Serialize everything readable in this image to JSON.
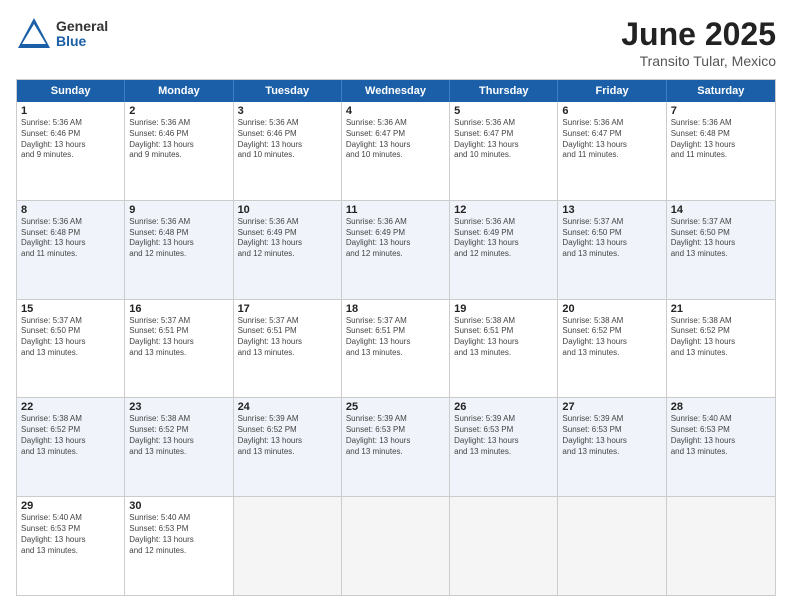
{
  "logo": {
    "general": "General",
    "blue": "Blue"
  },
  "title": "June 2025",
  "subtitle": "Transito Tular, Mexico",
  "header_days": [
    "Sunday",
    "Monday",
    "Tuesday",
    "Wednesday",
    "Thursday",
    "Friday",
    "Saturday"
  ],
  "rows": [
    [
      {
        "day": "1",
        "lines": [
          "Sunrise: 5:36 AM",
          "Sunset: 6:46 PM",
          "Daylight: 13 hours",
          "and 9 minutes."
        ]
      },
      {
        "day": "2",
        "lines": [
          "Sunrise: 5:36 AM",
          "Sunset: 6:46 PM",
          "Daylight: 13 hours",
          "and 9 minutes."
        ]
      },
      {
        "day": "3",
        "lines": [
          "Sunrise: 5:36 AM",
          "Sunset: 6:46 PM",
          "Daylight: 13 hours",
          "and 10 minutes."
        ]
      },
      {
        "day": "4",
        "lines": [
          "Sunrise: 5:36 AM",
          "Sunset: 6:47 PM",
          "Daylight: 13 hours",
          "and 10 minutes."
        ]
      },
      {
        "day": "5",
        "lines": [
          "Sunrise: 5:36 AM",
          "Sunset: 6:47 PM",
          "Daylight: 13 hours",
          "and 10 minutes."
        ]
      },
      {
        "day": "6",
        "lines": [
          "Sunrise: 5:36 AM",
          "Sunset: 6:47 PM",
          "Daylight: 13 hours",
          "and 11 minutes."
        ]
      },
      {
        "day": "7",
        "lines": [
          "Sunrise: 5:36 AM",
          "Sunset: 6:48 PM",
          "Daylight: 13 hours",
          "and 11 minutes."
        ]
      }
    ],
    [
      {
        "day": "8",
        "lines": [
          "Sunrise: 5:36 AM",
          "Sunset: 6:48 PM",
          "Daylight: 13 hours",
          "and 11 minutes."
        ]
      },
      {
        "day": "9",
        "lines": [
          "Sunrise: 5:36 AM",
          "Sunset: 6:48 PM",
          "Daylight: 13 hours",
          "and 12 minutes."
        ]
      },
      {
        "day": "10",
        "lines": [
          "Sunrise: 5:36 AM",
          "Sunset: 6:49 PM",
          "Daylight: 13 hours",
          "and 12 minutes."
        ]
      },
      {
        "day": "11",
        "lines": [
          "Sunrise: 5:36 AM",
          "Sunset: 6:49 PM",
          "Daylight: 13 hours",
          "and 12 minutes."
        ]
      },
      {
        "day": "12",
        "lines": [
          "Sunrise: 5:36 AM",
          "Sunset: 6:49 PM",
          "Daylight: 13 hours",
          "and 12 minutes."
        ]
      },
      {
        "day": "13",
        "lines": [
          "Sunrise: 5:37 AM",
          "Sunset: 6:50 PM",
          "Daylight: 13 hours",
          "and 13 minutes."
        ]
      },
      {
        "day": "14",
        "lines": [
          "Sunrise: 5:37 AM",
          "Sunset: 6:50 PM",
          "Daylight: 13 hours",
          "and 13 minutes."
        ]
      }
    ],
    [
      {
        "day": "15",
        "lines": [
          "Sunrise: 5:37 AM",
          "Sunset: 6:50 PM",
          "Daylight: 13 hours",
          "and 13 minutes."
        ]
      },
      {
        "day": "16",
        "lines": [
          "Sunrise: 5:37 AM",
          "Sunset: 6:51 PM",
          "Daylight: 13 hours",
          "and 13 minutes."
        ]
      },
      {
        "day": "17",
        "lines": [
          "Sunrise: 5:37 AM",
          "Sunset: 6:51 PM",
          "Daylight: 13 hours",
          "and 13 minutes."
        ]
      },
      {
        "day": "18",
        "lines": [
          "Sunrise: 5:37 AM",
          "Sunset: 6:51 PM",
          "Daylight: 13 hours",
          "and 13 minutes."
        ]
      },
      {
        "day": "19",
        "lines": [
          "Sunrise: 5:38 AM",
          "Sunset: 6:51 PM",
          "Daylight: 13 hours",
          "and 13 minutes."
        ]
      },
      {
        "day": "20",
        "lines": [
          "Sunrise: 5:38 AM",
          "Sunset: 6:52 PM",
          "Daylight: 13 hours",
          "and 13 minutes."
        ]
      },
      {
        "day": "21",
        "lines": [
          "Sunrise: 5:38 AM",
          "Sunset: 6:52 PM",
          "Daylight: 13 hours",
          "and 13 minutes."
        ]
      }
    ],
    [
      {
        "day": "22",
        "lines": [
          "Sunrise: 5:38 AM",
          "Sunset: 6:52 PM",
          "Daylight: 13 hours",
          "and 13 minutes."
        ]
      },
      {
        "day": "23",
        "lines": [
          "Sunrise: 5:38 AM",
          "Sunset: 6:52 PM",
          "Daylight: 13 hours",
          "and 13 minutes."
        ]
      },
      {
        "day": "24",
        "lines": [
          "Sunrise: 5:39 AM",
          "Sunset: 6:52 PM",
          "Daylight: 13 hours",
          "and 13 minutes."
        ]
      },
      {
        "day": "25",
        "lines": [
          "Sunrise: 5:39 AM",
          "Sunset: 6:53 PM",
          "Daylight: 13 hours",
          "and 13 minutes."
        ]
      },
      {
        "day": "26",
        "lines": [
          "Sunrise: 5:39 AM",
          "Sunset: 6:53 PM",
          "Daylight: 13 hours",
          "and 13 minutes."
        ]
      },
      {
        "day": "27",
        "lines": [
          "Sunrise: 5:39 AM",
          "Sunset: 6:53 PM",
          "Daylight: 13 hours",
          "and 13 minutes."
        ]
      },
      {
        "day": "28",
        "lines": [
          "Sunrise: 5:40 AM",
          "Sunset: 6:53 PM",
          "Daylight: 13 hours",
          "and 13 minutes."
        ]
      }
    ],
    [
      {
        "day": "29",
        "lines": [
          "Sunrise: 5:40 AM",
          "Sunset: 6:53 PM",
          "Daylight: 13 hours",
          "and 13 minutes."
        ]
      },
      {
        "day": "30",
        "lines": [
          "Sunrise: 5:40 AM",
          "Sunset: 6:53 PM",
          "Daylight: 13 hours",
          "and 12 minutes."
        ]
      },
      {
        "day": "",
        "lines": []
      },
      {
        "day": "",
        "lines": []
      },
      {
        "day": "",
        "lines": []
      },
      {
        "day": "",
        "lines": []
      },
      {
        "day": "",
        "lines": []
      }
    ]
  ]
}
